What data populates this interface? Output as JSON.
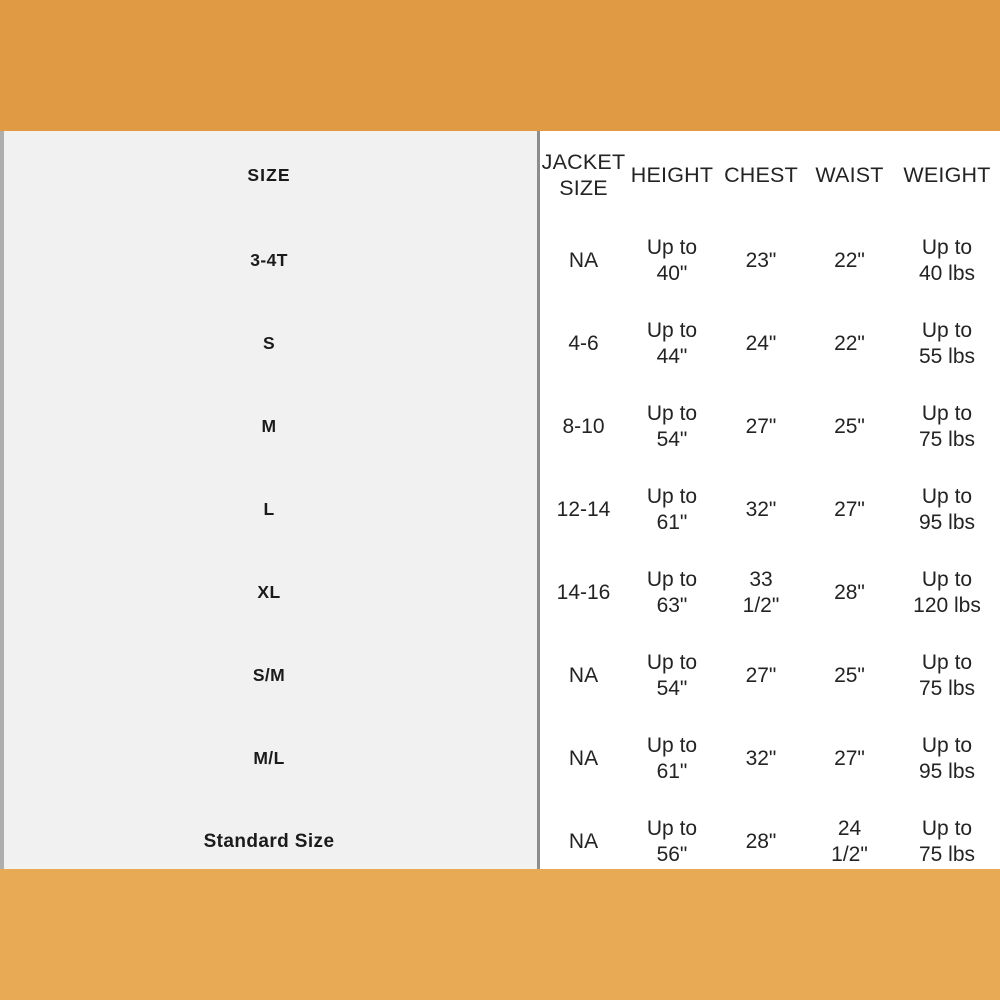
{
  "theme": {
    "band_top_color": "#e09a43",
    "band_bottom_color": "#e8aa54",
    "left_panel_color": "#f1f1f1",
    "right_panel_color": "#ffffff",
    "text_color": "#232323",
    "divider_color": "#8d8d8d"
  },
  "table": {
    "left_header": "SIZE",
    "columns": [
      "JACKET\nSIZE",
      "HEIGHT",
      "CHEST",
      "WAIST",
      "WEIGHT"
    ],
    "rows": [
      {
        "size": "3-4T",
        "jacket_size": "NA",
        "height": "Up to\n40\"",
        "chest": "23\"",
        "waist": "22\"",
        "weight": "Up to\n40 lbs"
      },
      {
        "size": "S",
        "jacket_size": "4-6",
        "height": "Up to\n44\"",
        "chest": "24\"",
        "waist": "22\"",
        "weight": "Up to\n55 lbs"
      },
      {
        "size": "M",
        "jacket_size": "8-10",
        "height": "Up to\n54\"",
        "chest": "27\"",
        "waist": "25\"",
        "weight": "Up to\n75 lbs"
      },
      {
        "size": "L",
        "jacket_size": "12-14",
        "height": "Up to\n61\"",
        "chest": "32\"",
        "waist": "27\"",
        "weight": "Up to\n95 lbs"
      },
      {
        "size": "XL",
        "jacket_size": "14-16",
        "height": "Up to\n63\"",
        "chest": "33\n1/2\"",
        "waist": "28\"",
        "weight": "Up to\n120 lbs"
      },
      {
        "size": "S/M",
        "jacket_size": "NA",
        "height": "Up to\n54\"",
        "chest": "27\"",
        "waist": "25\"",
        "weight": "Up to\n75 lbs"
      },
      {
        "size": "M/L",
        "jacket_size": "NA",
        "height": "Up to\n61\"",
        "chest": "32\"",
        "waist": "27\"",
        "weight": "Up to\n95 lbs"
      },
      {
        "size": "Standard Size",
        "jacket_size": "NA",
        "height": "Up to\n56\"",
        "chest": "28\"",
        "waist": "24\n1/2\"",
        "weight": "Up to\n75 lbs"
      }
    ]
  }
}
